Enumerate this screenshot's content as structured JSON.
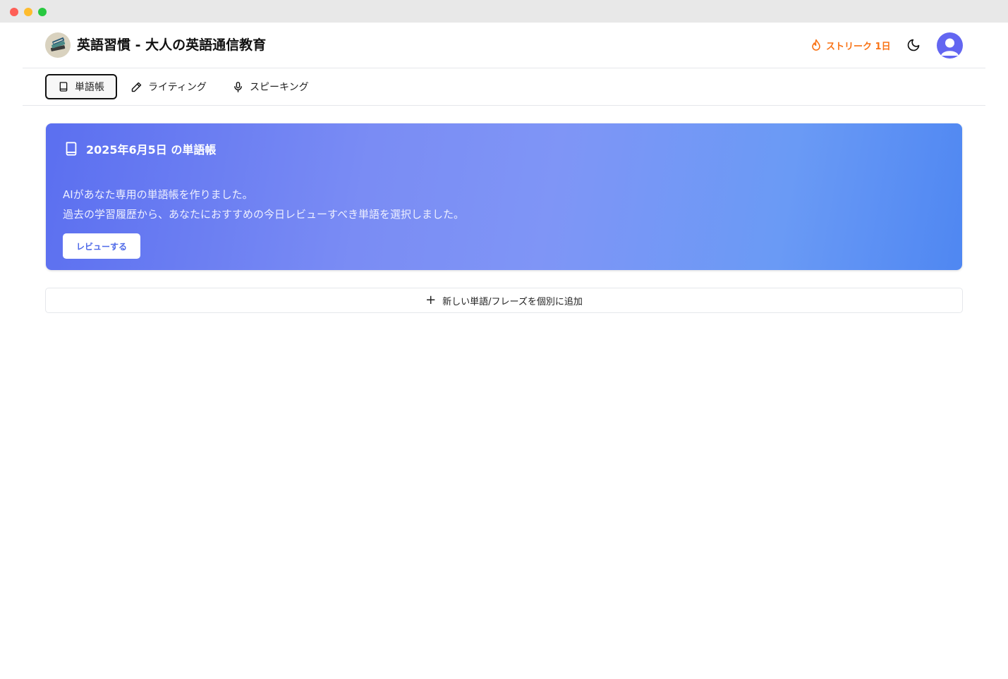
{
  "header": {
    "title": "英語習慣 - 大人の英語通信教育",
    "logo_icon": "book-stack-icon",
    "streak_label": "ストリーク 1日",
    "streak_color": "#f97316",
    "theme_icon": "moon-icon",
    "avatar_icon": "user-avatar-icon"
  },
  "nav": {
    "tabs": [
      {
        "label": "単語帳",
        "icon": "book-icon",
        "active": true
      },
      {
        "label": "ライティング",
        "icon": "pencil-icon",
        "active": false
      },
      {
        "label": "スピーキング",
        "icon": "microphone-icon",
        "active": false
      }
    ]
  },
  "hero": {
    "title": "2025年6月5日 の単語帳",
    "line1": "AIがあなた専用の単語帳を作りました。",
    "line2": "過去の学習履歴から、あなたにおすすめの今日レビューすべき単語を選択しました。",
    "button_label": "レビューする",
    "gradient_start": "#5b6ff0",
    "gradient_end": "#4f87f2"
  },
  "actions": {
    "add_label": "新しい単語/フレーズを個別に追加"
  }
}
